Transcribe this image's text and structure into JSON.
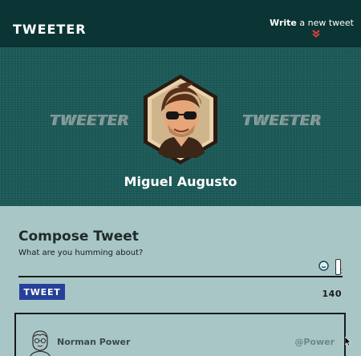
{
  "header": {
    "brand": "TWEETER",
    "write_link": {
      "strong": "Write",
      "rest": " a new tweet"
    }
  },
  "hero": {
    "ghost_left": "TWEETER",
    "ghost_right": "TWEETER",
    "profile_name": "Miguel Augusto"
  },
  "compose": {
    "title": "Compose Tweet",
    "placeholder": "What are you humming about?",
    "value": "",
    "tweet_button": "TWEET",
    "char_count": "140"
  },
  "tweets": [
    {
      "name": "Norman Power",
      "handle": "@Power"
    }
  ],
  "colors": {
    "topbar": "#0b3434",
    "hero": "#1d5b59",
    "page": "#a9c6c6",
    "button": "#27419a"
  },
  "icons": {
    "chevron": "double-chevron-down-icon",
    "emoji": "emoji-icon",
    "avatar": "profile-avatar",
    "tweet_avatar": "user-avatar-icon"
  }
}
